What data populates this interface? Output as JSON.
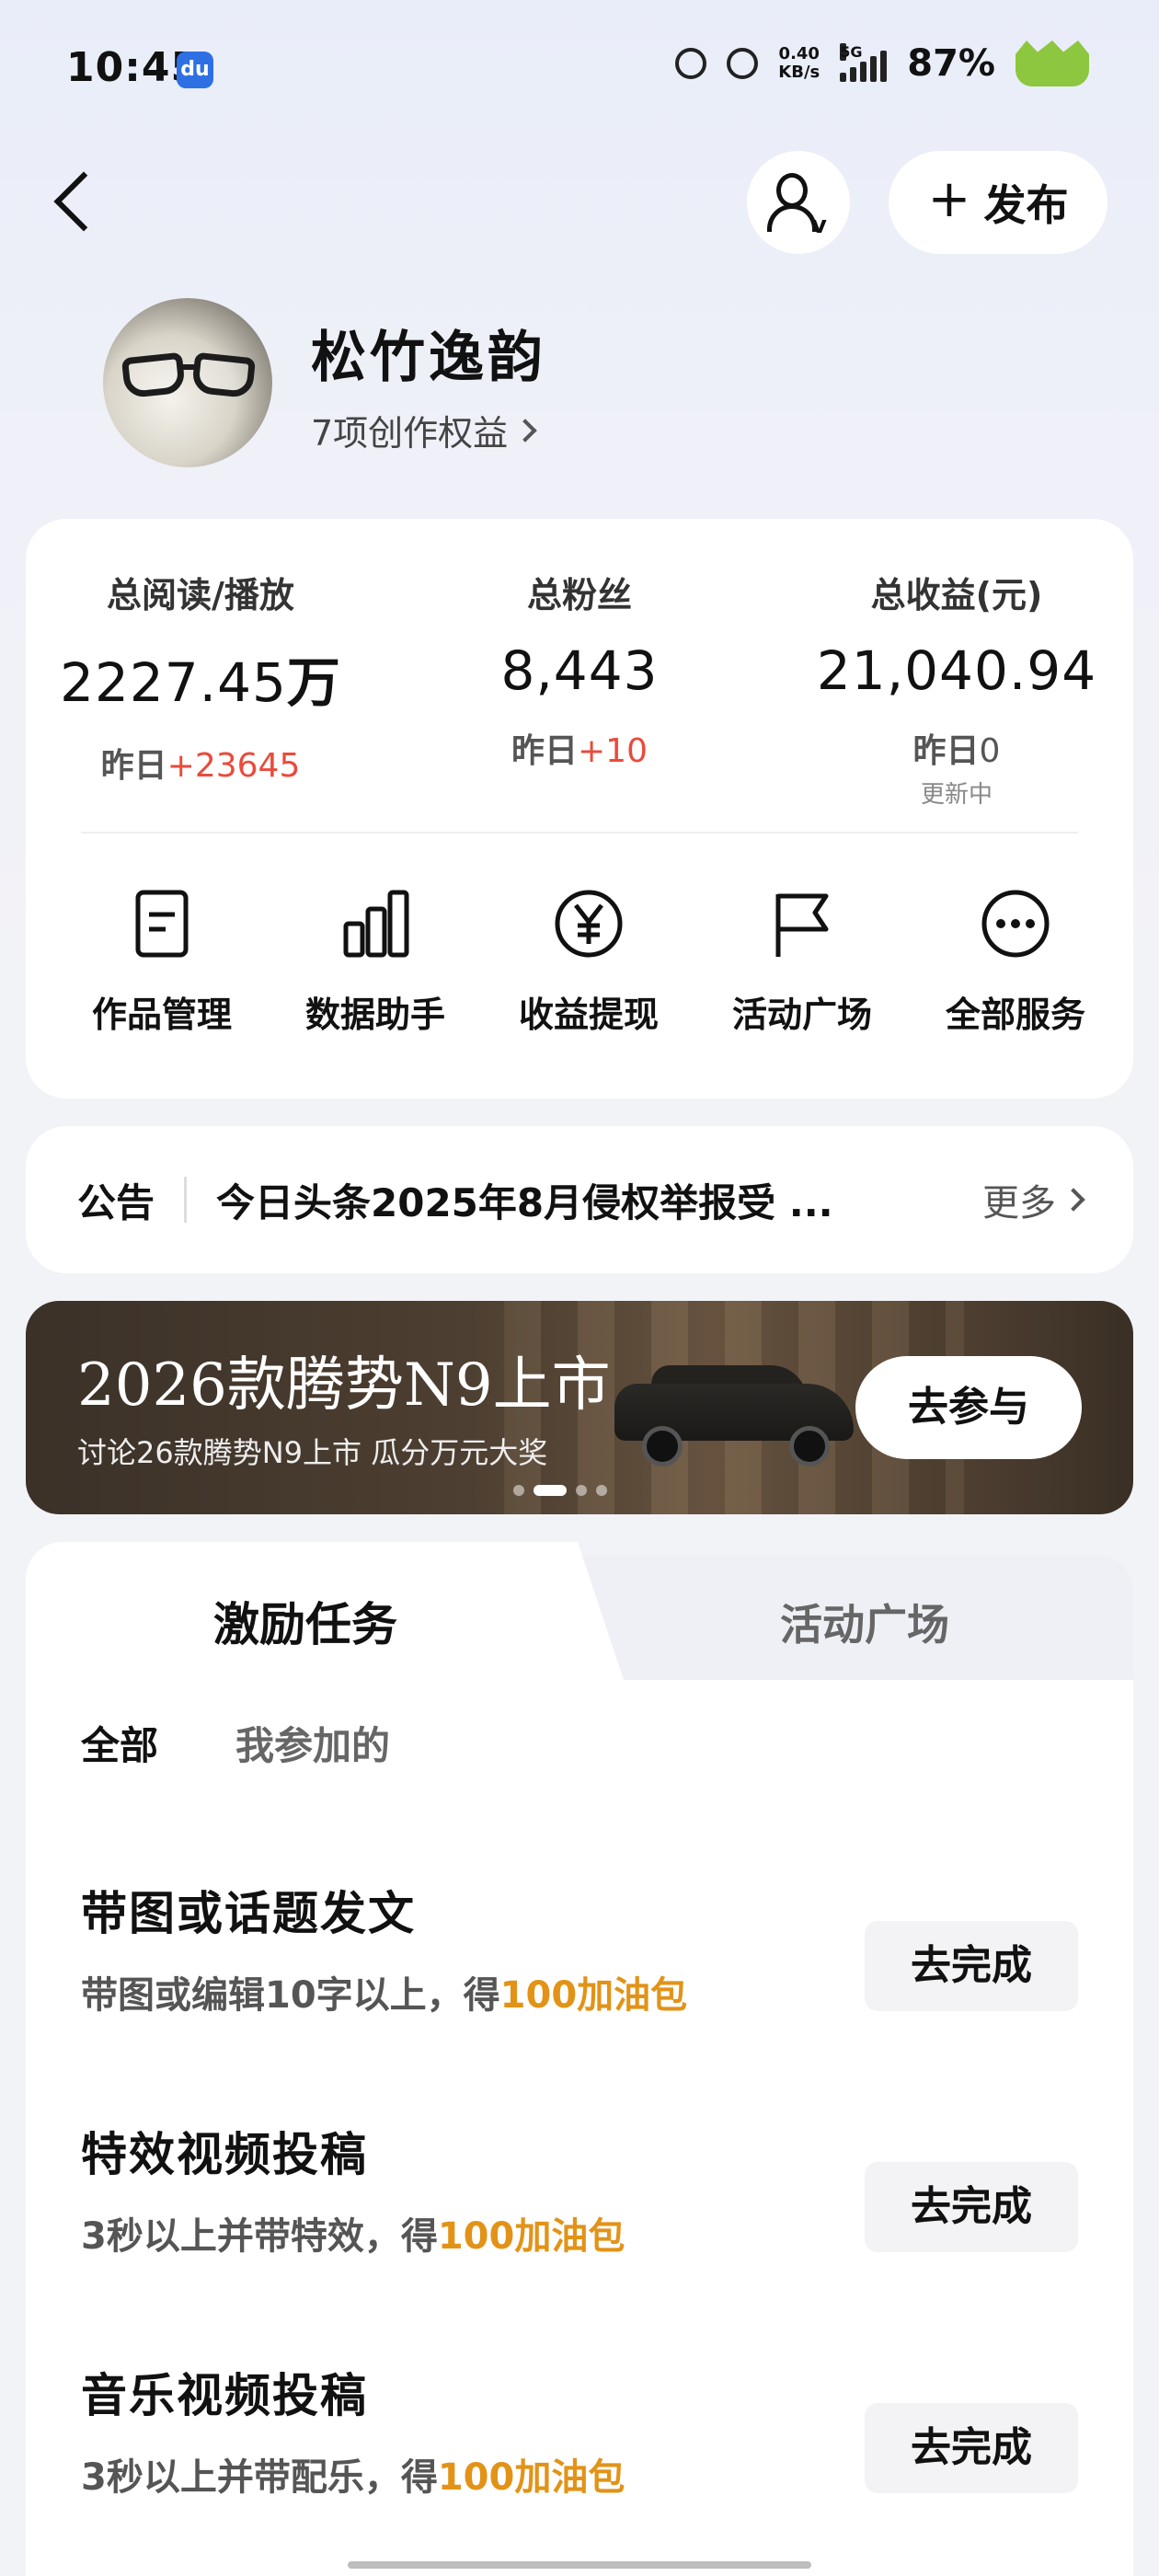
{
  "status_bar": {
    "time": "10:45",
    "net_speed_top": "0.40",
    "net_speed_bottom": "KB/s",
    "network": "5G",
    "battery": "87%"
  },
  "header": {
    "publish_label": "发布"
  },
  "profile": {
    "name": "松竹逸韵",
    "benefits": "7项创作权益"
  },
  "stats": [
    {
      "label": "总阅读/播放",
      "value": "2227.45",
      "unit": "万",
      "yday_prefix": "昨日",
      "yday_value": "+23645",
      "note": ""
    },
    {
      "label": "总粉丝",
      "value": "8,443",
      "unit": "",
      "yday_prefix": "昨日",
      "yday_value": "+10",
      "note": ""
    },
    {
      "label": "总收益(元)",
      "value": "21,040.94",
      "unit": "",
      "yday_prefix": "昨日",
      "yday_value": "0",
      "note": "更新中"
    }
  ],
  "services": [
    {
      "label": "作品管理",
      "icon": "document-icon"
    },
    {
      "label": "数据助手",
      "icon": "bar-chart-icon"
    },
    {
      "label": "收益提现",
      "icon": "yuan-icon"
    },
    {
      "label": "活动广场",
      "icon": "flag-icon"
    },
    {
      "label": "全部服务",
      "icon": "more-icon"
    }
  ],
  "notice": {
    "title": "公告",
    "text": "今日头条2025年8月侵权举报受 ...",
    "more": "更多"
  },
  "banner": {
    "title": "2026款腾势N9上市",
    "subtitle": "讨论26款腾势N9上市 瓜分万元大奖",
    "button": "去参与"
  },
  "tasks": {
    "tabs": [
      "激励任务",
      "活动广场"
    ],
    "filters": [
      "全部",
      "我参加的"
    ],
    "items": [
      {
        "title": "带图或话题发文",
        "desc": "带图或编辑10字以上，得",
        "reward": "100加油包",
        "button": "去完成"
      },
      {
        "title": "特效视频投稿",
        "desc": "3秒以上并带特效，得",
        "reward": "100加油包",
        "button": "去完成"
      },
      {
        "title": "音乐视频投稿",
        "desc": "3秒以上并带配乐，得",
        "reward": "100加油包",
        "button": "去完成"
      }
    ]
  }
}
